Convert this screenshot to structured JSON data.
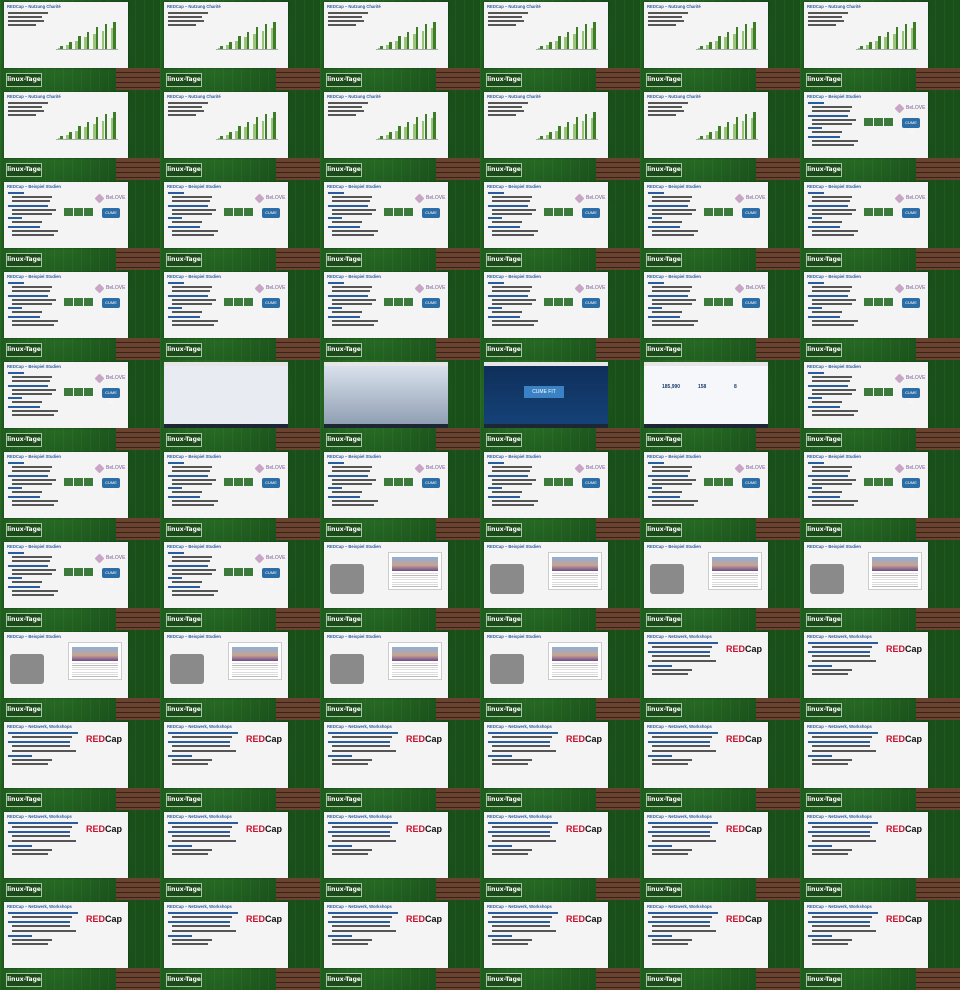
{
  "footer_logo_text": "linux-Tage",
  "slide_titles": {
    "charts": "REDCap – Nutzung Charité",
    "studies": "REDCap – Beispiel Studien",
    "network": "REDCap – Netzwerk, Workshops"
  },
  "brand_labels": {
    "betlove": "BeLOVE",
    "cumefit": "CUME FIT",
    "redcap_red": "RED",
    "redcap_black": "Cap"
  },
  "chart_data": {
    "type": "bar",
    "categories": [
      "1",
      "2",
      "3",
      "4",
      "5",
      "6",
      "7"
    ],
    "series": [
      {
        "values": [
          2,
          5,
          9,
          13,
          17,
          20,
          23
        ]
      },
      {
        "values": [
          4,
          8,
          14,
          19,
          24,
          27,
          29
        ]
      }
    ],
    "ylim": [
      0,
      30
    ],
    "colors": [
      "#9ac47a",
      "#3e7d27"
    ]
  },
  "screen_labels": {
    "counts": [
      "185,990",
      "158",
      "8"
    ],
    "brand": "CUME FIT"
  },
  "tiles": [
    "chart",
    "chart",
    "chart",
    "chart",
    "chart",
    "chart",
    "chart",
    "chart",
    "chart",
    "chart",
    "chart",
    "study",
    "study",
    "study",
    "study",
    "study",
    "study",
    "study",
    "study",
    "study",
    "study",
    "study",
    "study",
    "study",
    "study",
    "screen-dark",
    "screen-web",
    "screen-cume",
    "screen-stats",
    "study",
    "study",
    "study",
    "study",
    "study",
    "study",
    "study",
    "study",
    "study",
    "photo",
    "photo",
    "photo",
    "photo",
    "photo",
    "photo",
    "photo",
    "photo",
    "network",
    "network",
    "network",
    "network",
    "network",
    "network",
    "network",
    "network",
    "network",
    "network",
    "network",
    "network",
    "network",
    "network",
    "network",
    "network",
    "network",
    "network",
    "network",
    "network"
  ]
}
